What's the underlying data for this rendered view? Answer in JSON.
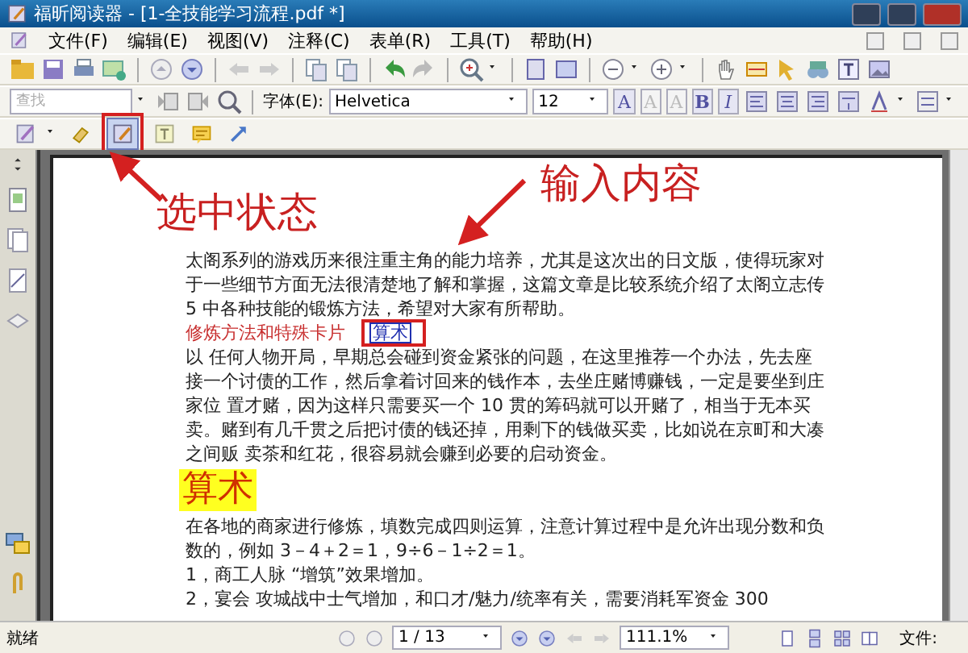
{
  "window": {
    "title": "福昕阅读器 - [1-全技能学习流程.pdf *]"
  },
  "menu": [
    "文件(F)",
    "编辑(E)",
    "视图(V)",
    "注释(C)",
    "表单(R)",
    "工具(T)",
    "帮助(H)"
  ],
  "format_toolbar": {
    "search": {
      "placeholder": "查找"
    },
    "font_label": "字体(E):",
    "font": "Helvetica",
    "size": "12",
    "letter_buttons": [
      {
        "label": "A",
        "disabled": false
      },
      {
        "label": "A",
        "disabled": true
      },
      {
        "label": "A",
        "disabled": true
      },
      {
        "label": "B",
        "disabled": false
      },
      {
        "label": "I",
        "disabled": false
      }
    ]
  },
  "annotation_tools": [
    {
      "kind": "pencil",
      "selected": false
    },
    {
      "kind": "eraser",
      "selected": false
    },
    {
      "kind": "typewriter",
      "selected": true
    },
    {
      "kind": "textbox",
      "selected": false
    },
    {
      "kind": "note",
      "selected": false
    },
    {
      "kind": "arrow",
      "selected": false
    }
  ],
  "callouts": [
    "选中状态",
    "输入内容"
  ],
  "document": {
    "blocks": [
      {
        "kind": "body",
        "text": "太阁系列的游戏历来很注重主角的能力培养，尤其是这次出的日文版，使得玩家对于一些细节方面无法很清楚地了解和掌握，这篇文章是比较系统介绍了太阁立志传 5 中各种技能的锻炼方法，希望对大家有所帮助。"
      },
      {
        "kind": "subheading",
        "text": "修炼方法和特殊卡片",
        "typed": "算术"
      },
      {
        "kind": "body",
        "text": "以 任何人物开局，早期总会碰到资金紧张的问题，在这里推荐一个办法，先去座接一个讨债的工作，然后拿着讨回来的钱作本，去坐庄赌博赚钱，一定是要坐到庄家位 置才赌，因为这样只需要买一个 10 贯的筹码就可以开赌了，相当于无本买卖。赌到有几千贯之后把讨债的钱还掉，用剩下的钱做买卖，比如说在京町和大凑之间贩 卖茶和红花，很容易就会赚到必要的启动资金。"
      },
      {
        "kind": "heading",
        "text": "算术"
      },
      {
        "kind": "body",
        "text": "在各地的商家进行修炼，填数完成四则运算，注意计算过程中是允许出现分数和负数的，例如 3－4＋2＝1，9÷6－1÷2＝1。"
      },
      {
        "kind": "body",
        "text": "1，商工人脉 “增筑”效果增加。"
      },
      {
        "kind": "body",
        "text": "2，宴会 攻城战中士气增加，和口才/魅力/统率有关，需要消耗军资金 300"
      }
    ]
  },
  "status_bar": {
    "text": "就绪",
    "page": "1 / 13",
    "zoom": "111.1%",
    "file_label": "文件:"
  }
}
